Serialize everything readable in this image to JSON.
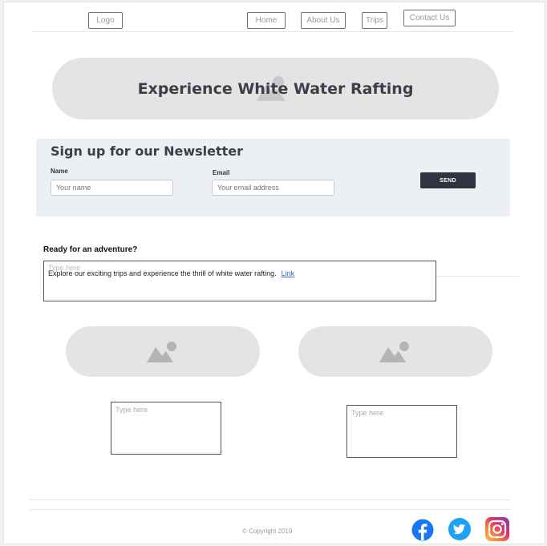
{
  "nav": {
    "logo": "Logo",
    "items": [
      {
        "label": "Home"
      },
      {
        "label": "About Us"
      },
      {
        "label": "Trips"
      },
      {
        "label": "Contact Us"
      }
    ]
  },
  "hero": {
    "title": "Experience White Water Rafting",
    "icon": "image-placeholder-icon"
  },
  "newsletter": {
    "title": "Sign up for our Newsletter",
    "name_label": "Name",
    "name_placeholder": "Your name",
    "email_label": "Email",
    "email_placeholder": "Your email address",
    "send_label": "SEND"
  },
  "adventure": {
    "heading": "Ready for an adventure?",
    "placeholder": "Type here",
    "text": "Explore our exciting trips and experience the thrill of white water rafting.",
    "link": "Link"
  },
  "cards": [
    {
      "icon": "image-placeholder-icon",
      "placeholder": "Type here"
    },
    {
      "icon": "image-placeholder-icon",
      "placeholder": "Type here"
    }
  ],
  "footer": {
    "copyright": "© Copyright 2019",
    "social": [
      {
        "icon": "facebook-icon",
        "color": "#1877f2"
      },
      {
        "icon": "twitter-icon",
        "color": "#1da1f2"
      },
      {
        "icon": "instagram-icon",
        "color": "#c13584"
      }
    ]
  },
  "colors": {
    "accent_dark": "#2f3440",
    "placeholder_gray": "#e4e4e4",
    "newsletter_bg": "#eceff3"
  }
}
